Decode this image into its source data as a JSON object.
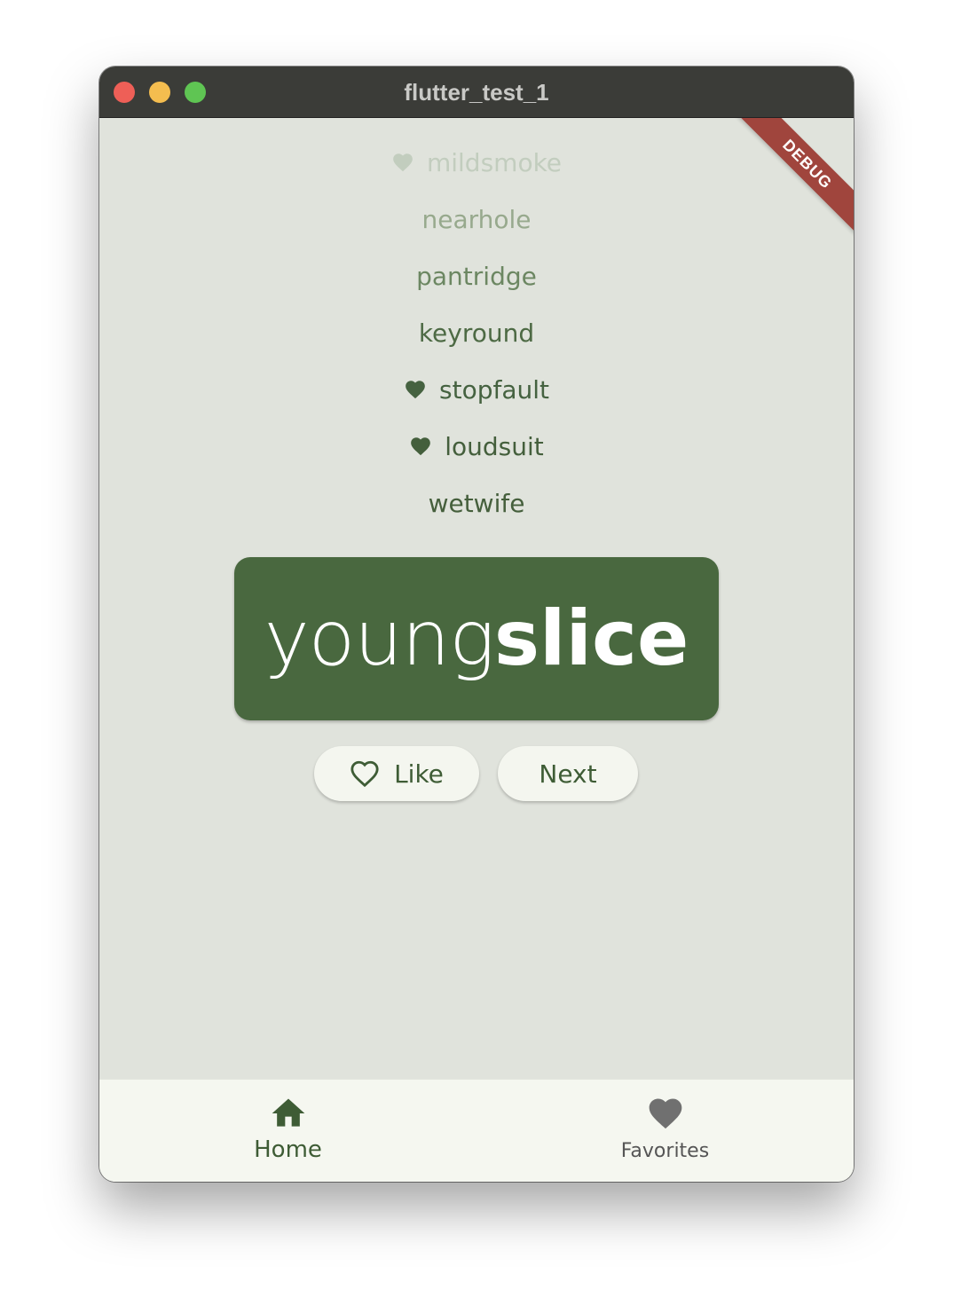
{
  "window": {
    "title": "flutter_test_1"
  },
  "debug_banner": "DEBUG",
  "history": [
    {
      "word": "mildsmoke",
      "favorite": true,
      "color": "#c2cdbe"
    },
    {
      "word": "nearhole",
      "favorite": false,
      "color": "#97a98d"
    },
    {
      "word": "pantridge",
      "favorite": false,
      "color": "#6c8762"
    },
    {
      "word": "keyround",
      "favorite": false,
      "color": "#4d6a44"
    },
    {
      "word": "stopfault",
      "favorite": true,
      "color": "#456240"
    },
    {
      "word": "loudsuit",
      "favorite": true,
      "color": "#445f3c"
    },
    {
      "word": "wetwife",
      "favorite": false,
      "color": "#455f3c"
    }
  ],
  "current_pair": {
    "first": "young",
    "second": "slice"
  },
  "buttons": {
    "like_label": "Like",
    "next_label": "Next"
  },
  "bottom_nav": {
    "home_label": "Home",
    "favorites_label": "Favorites",
    "selected": "Home"
  },
  "icons": {
    "history_favorite": "heart-filled-icon",
    "like": "heart-outline-icon",
    "home": "home-icon",
    "favorites": "heart-filled-icon"
  },
  "colors": {
    "primary": "#49683f",
    "background": "#e0e3dc",
    "surface": "#f5f7f0",
    "titlebar": "#3b3c38",
    "debug": "#a0453d"
  }
}
